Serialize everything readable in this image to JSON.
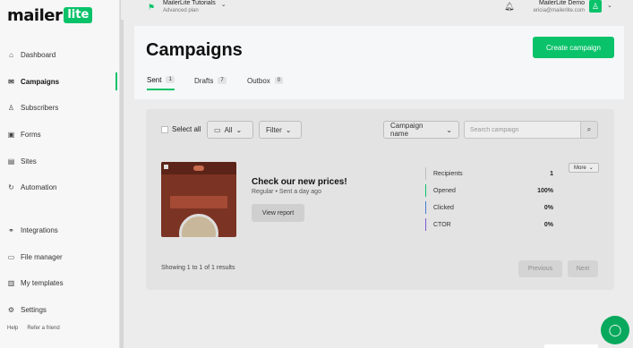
{
  "logo": {
    "text": "mailer",
    "badge": "lite"
  },
  "sidebar": {
    "items": [
      {
        "label": "Dashboard",
        "icon": "⌂"
      },
      {
        "label": "Campaigns",
        "icon": "✉"
      },
      {
        "label": "Subscribers",
        "icon": "♙"
      },
      {
        "label": "Forms",
        "icon": "▣"
      },
      {
        "label": "Sites",
        "icon": "▤"
      },
      {
        "label": "Automation",
        "icon": "↻"
      },
      {
        "label": "Integrations",
        "icon": "⚭"
      },
      {
        "label": "File manager",
        "icon": "▭"
      },
      {
        "label": "My templates",
        "icon": "▥"
      },
      {
        "label": "Settings",
        "icon": "⚙"
      }
    ],
    "active": "Campaigns",
    "help": "Help",
    "refer": "Refer a friend"
  },
  "topbar": {
    "account_name": "MailerLite Tutorials",
    "account_plan": "Advanced plan",
    "user_name": "MailerLite Demo",
    "user_email": "ericia@mailerlite.com"
  },
  "header": {
    "title": "Campaigns",
    "create_label": "Create campaign",
    "tabs": [
      {
        "label": "Sent",
        "count": "1"
      },
      {
        "label": "Drafts",
        "count": "7"
      },
      {
        "label": "Outbox",
        "count": "0"
      }
    ]
  },
  "toolbar": {
    "select_all": "Select all",
    "folder_filter": "All",
    "filter": "Filter",
    "sort": "Campaign name",
    "search_placeholder": "Search campaign"
  },
  "campaign": {
    "title": "Check our new prices!",
    "type": "Regular",
    "sent": "Sent a day ago",
    "view_report": "View report",
    "more": "More",
    "stats": [
      {
        "label": "Recipients",
        "value": "1",
        "color": "#bdbdbd"
      },
      {
        "label": "Opened",
        "value": "100%",
        "color": "#09c269"
      },
      {
        "label": "Clicked",
        "value": "0%",
        "color": "#4a7bd6"
      },
      {
        "label": "CTOR",
        "value": "0%",
        "color": "#7a5ad6"
      }
    ]
  },
  "pagination": {
    "showing": "Showing 1 to 1 of 1 results",
    "previous": "Previous",
    "next": "Next"
  }
}
